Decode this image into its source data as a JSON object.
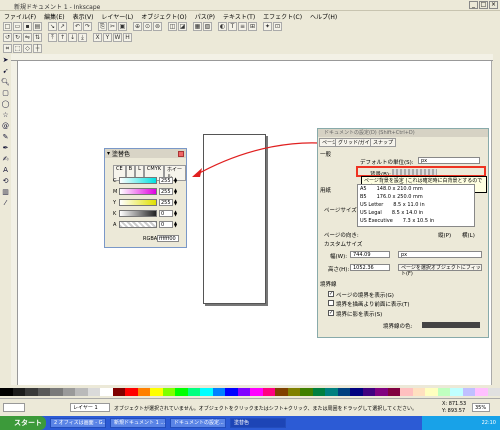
{
  "window": {
    "title": "新規ドキュメント 1 - Inkscape"
  },
  "menu": [
    "ファイル(F)",
    "編集(E)",
    "表示(V)",
    "レイヤー(L)",
    "オブジェクト(O)",
    "パス(P)",
    "テキスト(T)",
    "エフェクト(C)",
    "ヘルプ(H)"
  ],
  "toolbar": {
    "rows": 3
  },
  "fill_window": {
    "title": "塗替色",
    "tabs": [
      "CE",
      "B",
      "L",
      "CMYK",
      "ホイール"
    ],
    "channels": [
      {
        "label": "C",
        "value": "255",
        "color": "#00e0e0"
      },
      {
        "label": "M",
        "value": "255",
        "color": "#e000e0"
      },
      {
        "label": "Y",
        "value": "255",
        "color": "#e0e000"
      },
      {
        "label": "K",
        "value": "0",
        "color": "#555555"
      },
      {
        "label": "A",
        "value": "0",
        "color": "#cccccc"
      }
    ],
    "rgba_label": "RGBA:",
    "rgba_value": "ffffff00"
  },
  "doc_window": {
    "title": "ドキュメントの設定(D) (Shift+Ctrl+D)",
    "tabs": [
      "ページ",
      "グリッド/ガイド",
      "スナップ"
    ],
    "section_general": "一般",
    "default_units_label": "デフォルトの単位(S):",
    "default_units_value": "px",
    "background_label": "背景(B):",
    "tooltip": "ページ背景を設定 (これは確定時に白背景とするのでエクスポートの見やすさ向上)",
    "paper_label": "用紙",
    "page_size_label": "ページサイズ(F):",
    "page_sizes": [
      {
        "name": "A5",
        "dim": "148.0 x 210.0 mm"
      },
      {
        "name": "B5",
        "dim": "176.0 x 250.0 mm"
      },
      {
        "name": "US Letter",
        "dim": "8.5 x 11.0 in"
      },
      {
        "name": "US Legal",
        "dim": "8.5 x 14.0 in"
      },
      {
        "name": "US Executive",
        "dim": "7.3 x 10.5 in"
      }
    ],
    "orientation_label": "ページの向き:",
    "orientation_portrait": "縦(P)",
    "orientation_landscape": "横(L)",
    "custom_size_label": "カスタムサイズ",
    "width_label": "幅(W):",
    "width_value": "744.09",
    "height_label": "高さ(H):",
    "height_value": "1052.36",
    "units_value": "px",
    "fit_button": "ページを選択オブジェクトにフィット(F)",
    "border_label": "境界線",
    "check_border": "ページの境界を表示(G)",
    "check_border_top": "境界を描画より前面に表示(T)",
    "check_shadow": "境界に影を表示(S)",
    "border_color_label": "境界線の色:"
  },
  "statusbar": {
    "layer": "レイヤー 1",
    "message": "オブジェクトが選択されていません。オブジェクトをクリックまたはシフト+クリック、または周囲をドラッグして選択してください。",
    "x": "X: 871.53",
    "y": "Y: 893.57",
    "zoom": "35%"
  },
  "taskbar": {
    "start": "スタート",
    "tasks": [
      "2 オフィスは画面 - G...",
      "新規ドキュメント 1 ...",
      "ドキュメントの設定...",
      "塗替色"
    ],
    "clock": "22:10"
  },
  "palette": [
    "#000000",
    "#1c1c1c",
    "#3a3a3a",
    "#5a5a5a",
    "#7a7a7a",
    "#9a9a9a",
    "#bababa",
    "#dadada",
    "#ffffff",
    "#800000",
    "#ff0000",
    "#ff8000",
    "#ffff00",
    "#80ff00",
    "#00ff00",
    "#00ff80",
    "#00ffff",
    "#0080ff",
    "#0000ff",
    "#8000ff",
    "#ff00ff",
    "#ff0080",
    "#804000",
    "#808000",
    "#408000",
    "#008040",
    "#008080",
    "#004080",
    "#000080",
    "#400080",
    "#800080",
    "#800040",
    "#ffc0c0",
    "#ffe0c0",
    "#ffffc0",
    "#c0ffc0",
    "#c0ffff",
    "#c0c0ff",
    "#ffc0ff",
    "#e0e0e0"
  ]
}
